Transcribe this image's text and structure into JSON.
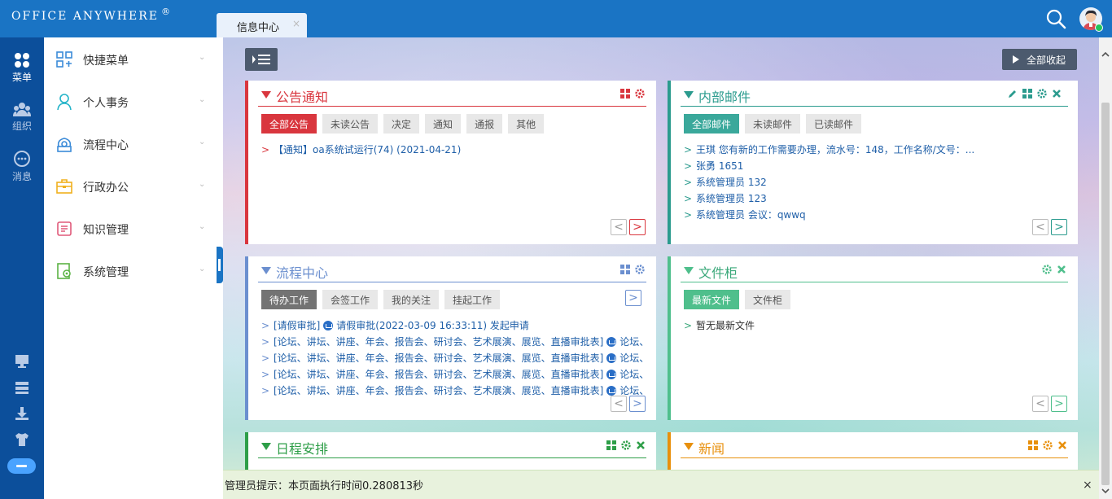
{
  "app": {
    "logo_text": "Office Anywhere",
    "logo_mark": "®"
  },
  "tab": {
    "label": "信息中心",
    "close": "×"
  },
  "colors": {
    "brand_blue": "#1a74c4",
    "rail_blue": "#0c4f9b",
    "red": "#d9363e",
    "teal": "#2b9b8e",
    "green": "#2e9e48",
    "orange": "#e8900c",
    "slate": "#4c5a6e",
    "flow_blue": "#6b8fcf"
  },
  "rail": {
    "items": [
      {
        "label": "菜单",
        "icon": "menu-grid-icon"
      },
      {
        "label": "组织",
        "icon": "organization-icon"
      },
      {
        "label": "消息",
        "icon": "message-icon"
      }
    ],
    "bottom_icons": [
      "desktop-icon",
      "server-icon",
      "download-icon",
      "shirt-icon",
      "more-toggle-icon"
    ]
  },
  "sidebar": {
    "items": [
      {
        "label": "快捷菜单",
        "icon": "quick-menu-icon"
      },
      {
        "label": "个人事务",
        "icon": "person-icon"
      },
      {
        "label": "流程中心",
        "icon": "workflow-icon"
      },
      {
        "label": "行政办公",
        "icon": "briefcase-icon"
      },
      {
        "label": "知识管理",
        "icon": "book-icon"
      },
      {
        "label": "系统管理",
        "icon": "settings-page-icon"
      }
    ],
    "chevron": "⌄"
  },
  "toolbar": {
    "collapse_all": "全部收起"
  },
  "panels": {
    "announcements": {
      "title": "公告通知",
      "tabs": [
        "全部公告",
        "未读公告",
        "决定",
        "通知",
        "通报",
        "其他"
      ],
      "items": [
        "【通知】oa系统试运行(74) (2021-04-21)"
      ]
    },
    "mail": {
      "title": "内部邮件",
      "tabs": [
        "全部邮件",
        "未读邮件",
        "已读邮件"
      ],
      "items": [
        "王琪 您有新的工作需要办理，流水号：148，工作名称/文号：...",
        "张勇 1651",
        "系统管理员 132",
        "系统管理员 123",
        "系统管理员 会议：qwwq"
      ]
    },
    "workflow": {
      "title": "流程中心",
      "tabs": [
        "待办工作",
        "会签工作",
        "我的关注",
        "挂起工作"
      ],
      "items": [
        {
          "prefix": "[请假审批]",
          "text": "请假审批(2022-03-09 16:33:11) 发起申请"
        },
        {
          "prefix": "[论坛、讲坛、讲座、年会、报告会、研讨会、艺术展演、展览、直播审批表]",
          "text": "论坛、"
        },
        {
          "prefix": "[论坛、讲坛、讲座、年会、报告会、研讨会、艺术展演、展览、直播审批表]",
          "text": "论坛、"
        },
        {
          "prefix": "[论坛、讲坛、讲座、年会、报告会、研讨会、艺术展演、展览、直播审批表]",
          "text": "论坛、"
        },
        {
          "prefix": "[论坛、讲坛、讲座、年会、报告会、研讨会、艺术展演、展览、直播审批表]",
          "text": "论坛、"
        }
      ]
    },
    "files": {
      "title": "文件柜",
      "tabs": [
        "最新文件",
        "文件柜"
      ],
      "items": [
        "暂无最新文件"
      ]
    },
    "schedule": {
      "title": "日程安排"
    },
    "news": {
      "title": "新闻"
    }
  },
  "list_marker": ">",
  "pager": {
    "prev": "<",
    "next": ">"
  },
  "admin_tip": {
    "text": "管理员提示：本页面执行时间0.280813秒",
    "close": "×"
  }
}
